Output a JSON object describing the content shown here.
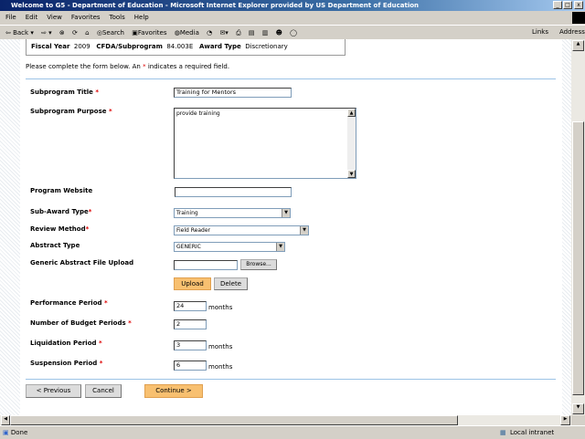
{
  "window": {
    "title": "Welcome to G5 - Department of Education - Microsoft Internet Explorer provided by US Department of Education"
  },
  "menu": [
    "File",
    "Edit",
    "View",
    "Favorites",
    "Tools",
    "Help"
  ],
  "toolbar": {
    "back": "Back",
    "search": "Search",
    "favorites": "Favorites",
    "media": "Media",
    "links": "Links",
    "address": "Address"
  },
  "summary": {
    "fiscal_year_label": "Fiscal Year",
    "fiscal_year": "2009",
    "cfda_label": "CFDA/Subprogram",
    "cfda": "84.003E",
    "award_type_label": "Award Type",
    "award_type": "Discretionary"
  },
  "intro": {
    "before": "Please complete the form below. An ",
    "star": "*",
    "after": " indicates a required field."
  },
  "form": {
    "title_label": "Subprogram Title",
    "title_value": "Training for Mentors",
    "purpose_label": "Subprogram Purpose",
    "purpose_value": "provide training",
    "website_label": "Program Website",
    "website_value": "",
    "subaward_label": "Sub-Award Type",
    "subaward_value": "Training",
    "review_label": "Review Method",
    "review_value": "Field Reader",
    "abstract_label": "Abstract Type",
    "abstract_value": "GENERIC",
    "upload_label": "Generic Abstract File Upload",
    "browse": "Browse...",
    "upload": "Upload",
    "delete": "Delete",
    "performance_label": "Performance Period",
    "performance_value": "24",
    "budget_label": "Number of Budget Periods",
    "budget_value": "2",
    "liquidation_label": "Liquidation Period",
    "liquidation_value": "3",
    "suspension_label": "Suspension Period",
    "suspension_value": "6",
    "months": "months",
    "star": "*"
  },
  "buttons": {
    "previous": "< Previous",
    "cancel": "Cancel",
    "continue": "Continue >"
  },
  "status": {
    "text": "Done",
    "zone": "Local intranet"
  }
}
